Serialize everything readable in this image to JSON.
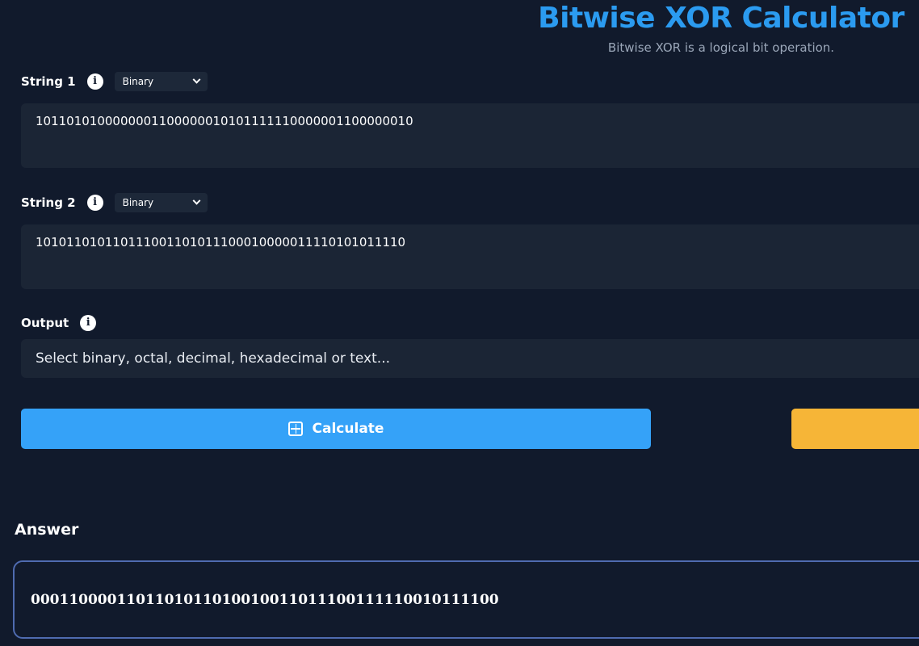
{
  "header": {
    "title": "Bitwise XOR Calculator",
    "subtitle": "Bitwise XOR is a logical bit operation."
  },
  "string1": {
    "label": "String 1",
    "info_icon": "info-icon",
    "format": "Binary",
    "value": "1011010100000001100000010101111110000001100000010"
  },
  "string2": {
    "label": "String 2",
    "info_icon": "info-icon",
    "format": "Binary",
    "value": "101011010110111001101011100010000011110101011110"
  },
  "output": {
    "label": "Output",
    "info_icon": "info-icon",
    "placeholder": "Select binary, octal, decimal, hexadecimal or text..."
  },
  "actions": {
    "calculate_label": "Calculate",
    "calculate_icon": "calculator-icon",
    "calculate_color": "#35a2f8",
    "reset_color": "#f6b537"
  },
  "answer": {
    "label": "Answer",
    "value": "0001100001101101011010010011011100111110010111100"
  },
  "colors": {
    "background": "#111a2c",
    "title": "#2b9bf0",
    "field": "#1b2535",
    "answer_border": "#4f6bb0"
  }
}
